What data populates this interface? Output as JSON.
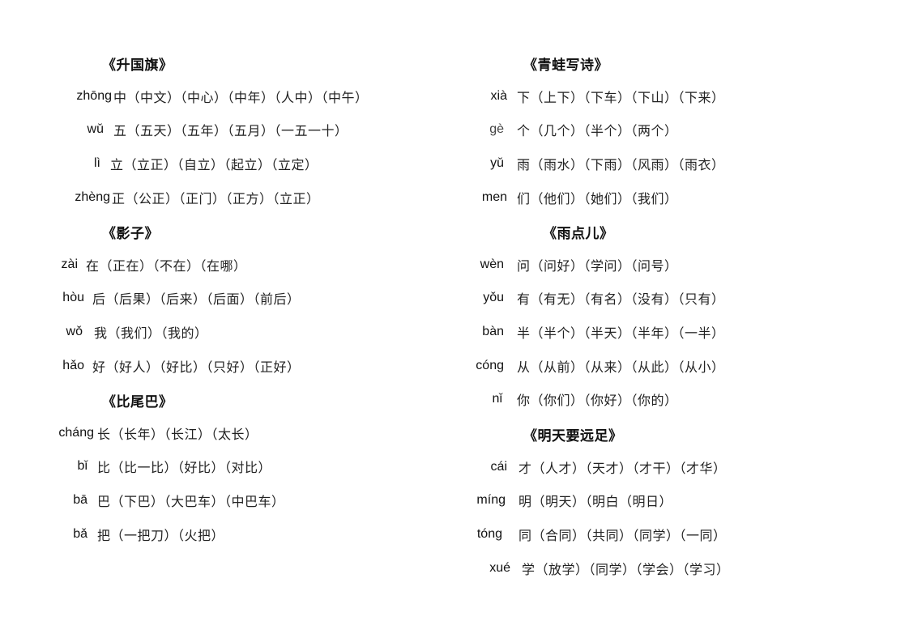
{
  "left": {
    "sections": [
      {
        "title": "《升国旗》",
        "rows": [
          {
            "pinyin": "zhōng",
            "words": "中（中文）（中心）（中年）（人中）（中午）"
          },
          {
            "pinyin": "wǔ",
            "words": "五（五天）（五年）（五月）（一五一十）"
          },
          {
            "pinyin": "lì",
            "words": "立（立正）（自立）（起立）（立定）"
          },
          {
            "pinyin": "zhèng",
            "words": "正（公正）（正门）（正方）（立正）"
          }
        ]
      },
      {
        "title": "《影子》",
        "rows": [
          {
            "pinyin": "zài",
            "words": "在（正在）（不在）（在哪）"
          },
          {
            "pinyin": "hòu",
            "words": "后（后果）（后来）（后面）（前后）"
          },
          {
            "pinyin": "wǒ",
            "words": "我（我们）（我的）"
          },
          {
            "pinyin": "hǎo",
            "words": "好（好人）（好比）（只好）（正好）"
          }
        ]
      },
      {
        "title": "《比尾巴》",
        "rows": [
          {
            "pinyin": "cháng",
            "words": "长（长年）（长江）（太长）"
          },
          {
            "pinyin": "bǐ",
            "words": "比（比一比）（好比）（对比）"
          },
          {
            "pinyin": "bā",
            "words": "巴（下巴）（大巴车）（中巴车）"
          },
          {
            "pinyin": "bǎ",
            "words": "把（一把刀）（火把）"
          }
        ]
      }
    ]
  },
  "right": {
    "sections": [
      {
        "title": "《青蛙写诗》",
        "rows": [
          {
            "pinyin": "xià",
            "words": "下（上下）（下车）（下山）（下来）"
          },
          {
            "pinyin": "gè",
            "words": "个（几个）（半个）（两个）"
          },
          {
            "pinyin": "yǔ",
            "words": "雨（雨水）（下雨）（风雨）（雨衣）"
          },
          {
            "pinyin": "men",
            "words": "们（他们）（她们）（我们）"
          }
        ]
      },
      {
        "title": "《雨点儿》",
        "rows": [
          {
            "pinyin": "wèn",
            "words": "问（问好）（学问）（问号）"
          },
          {
            "pinyin": "yǒu",
            "words": "有（有无）（有名）（没有）（只有）"
          },
          {
            "pinyin": "bàn",
            "words": "半（半个）（半天）（半年）（一半）"
          },
          {
            "pinyin": "cóng",
            "words": "从（从前）（从来）（从此）（从小）"
          },
          {
            "pinyin": "nǐ",
            "words": "你（你们）（你好）（你的）"
          }
        ]
      },
      {
        "title": "《明天要远足》",
        "rows": [
          {
            "pinyin": "cái",
            "words": "才（人才）（天才）（才干）（才华）"
          },
          {
            "pinyin": "míng",
            "words": "明（明天）（明白（明日）"
          },
          {
            "pinyin": "tóng",
            "words": "同（合同）（共同）（同学）（一同）"
          },
          {
            "pinyin": "xué",
            "words": "学（放学）（同学）（学会）（学习）"
          }
        ]
      }
    ]
  }
}
